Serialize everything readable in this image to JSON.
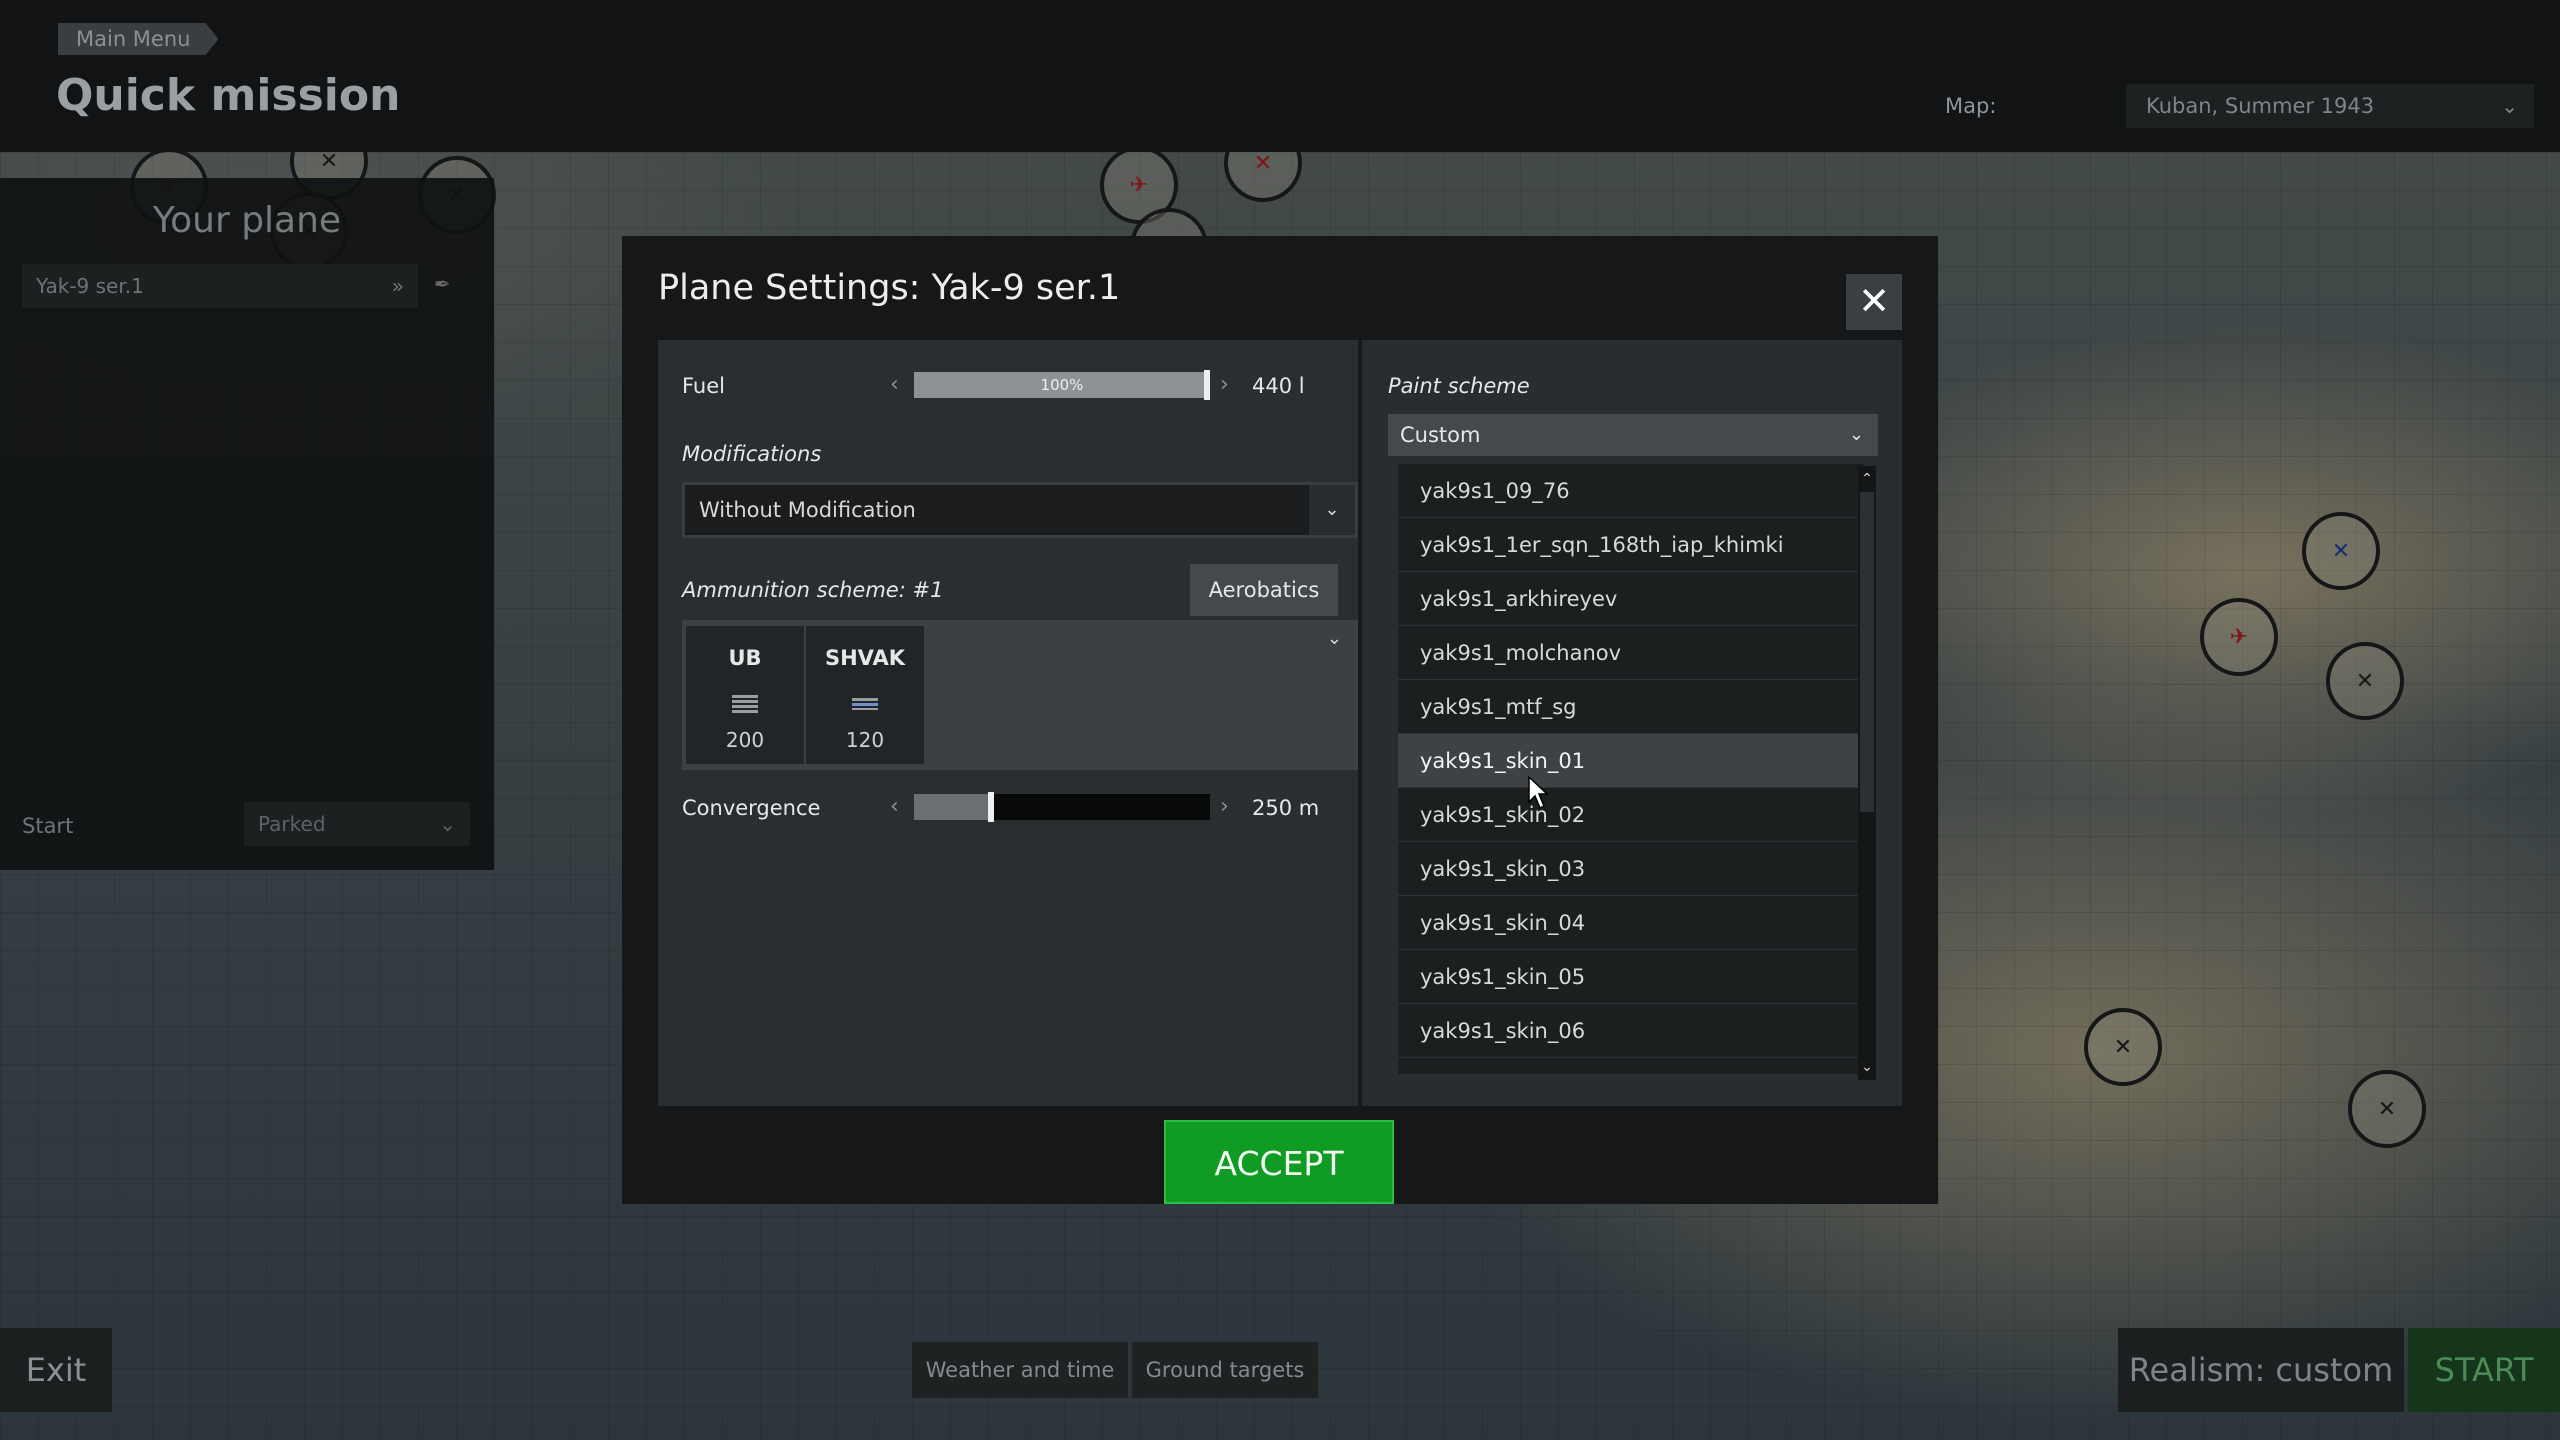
{
  "header": {
    "breadcrumb": "Main Menu",
    "title": "Quick mission",
    "map_label": "Map:",
    "map_value": "Kuban, Summer 1943"
  },
  "left_panel": {
    "title": "Your plane",
    "plane": "Yak-9 ser.1",
    "start_label": "Start",
    "start_value": "Parked"
  },
  "bottom": {
    "exit": "Exit",
    "weather": "Weather and time",
    "ground": "Ground targets",
    "realism": "Realism: custom",
    "start": "START"
  },
  "modal": {
    "title": "Plane Settings: Yak-9 ser.1",
    "close_icon": "close-icon",
    "fuel": {
      "label": "Fuel",
      "percent_label": "100%",
      "level_fraction": 1.0,
      "value": "440 l"
    },
    "modifications": {
      "label": "Modifications",
      "value": "Without Modification"
    },
    "ammo": {
      "label": "Ammunition scheme: #1",
      "aerobatics_label": "Aerobatics",
      "guns": [
        {
          "name": "UB",
          "count": "200",
          "icon": "bullet-belt-icon"
        },
        {
          "name": "SHVAK",
          "count": "120",
          "icon": "shell-belt-icon"
        }
      ]
    },
    "convergence": {
      "label": "Convergence",
      "value": "250 m",
      "level_fraction": 0.25
    },
    "paint": {
      "label": "Paint scheme",
      "value": "Custom",
      "items": [
        "yak9s1_09_76",
        "yak9s1_1er_sqn_168th_iap_khimki",
        "yak9s1_arkhireyev",
        "yak9s1_molchanov",
        "yak9s1_mtf_sg",
        "yak9s1_skin_01",
        "yak9s1_skin_02",
        "yak9s1_skin_03",
        "yak9s1_skin_04",
        "yak9s1_skin_05",
        "yak9s1_skin_06"
      ],
      "hovered": "yak9s1_skin_01"
    },
    "accept": "ACCEPT"
  },
  "colors": {
    "accept_green": "#0f9b24",
    "start_green": "#16361b",
    "panel_dark": "#151718"
  }
}
